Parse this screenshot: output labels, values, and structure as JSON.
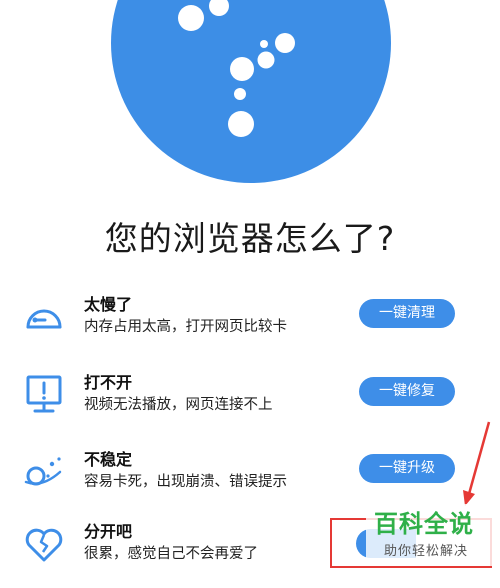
{
  "colors": {
    "brand_blue": "#3e8ee8",
    "highlight_red": "#e53935",
    "watermark_green": "#2fb049"
  },
  "page": {
    "title": "您的浏览器怎么了?"
  },
  "problems": [
    {
      "icon": "speedometer-icon",
      "title": "太慢了",
      "desc": "内存占用太高，打开网页比较卡",
      "action": "一键清理"
    },
    {
      "icon": "monitor-warning-icon",
      "title": "打不开",
      "desc": "视频无法播放，网页连接不上",
      "action": "一键修复"
    },
    {
      "icon": "unstable-orbit-icon",
      "title": "不稳定",
      "desc": "容易卡死，出现崩溃、错误提示",
      "action": "一键升级"
    },
    {
      "icon": "broken-heart-icon",
      "title": "分开吧",
      "desc": "很累，感觉自己不会再爱了",
      "action": ""
    }
  ],
  "watermark": {
    "title": "百科全说",
    "subtitle": "助你轻松解决"
  }
}
